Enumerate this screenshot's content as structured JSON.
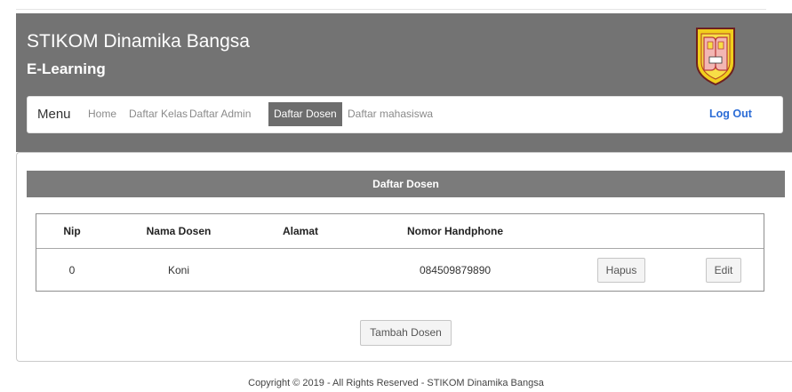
{
  "header": {
    "title": "STIKOM Dinamika Bangsa",
    "subtitle": "E-Learning",
    "logo_icon": "stikom-shield-logo"
  },
  "nav": {
    "menu_label": "Menu",
    "items": [
      {
        "label": "Home",
        "active": false
      },
      {
        "label": "Daftar Kelas",
        "active": false
      },
      {
        "label": "Daftar Admin",
        "active": false
      },
      {
        "label": "Daftar Dosen",
        "active": true
      },
      {
        "label": "Daftar mahasiswa",
        "active": false
      }
    ],
    "logout_label": "Log Out"
  },
  "panel": {
    "heading": "Daftar Dosen",
    "table": {
      "columns": [
        "Nip",
        "Nama Dosen",
        "Alamat",
        "Nomor Handphone"
      ],
      "rows": [
        {
          "nip": "0",
          "nama": "Koni",
          "alamat": "",
          "hp": "084509879890",
          "delete_label": "Hapus",
          "edit_label": "Edit"
        }
      ]
    },
    "add_button_label": "Tambah Dosen"
  },
  "footer": {
    "copyright": "Copyright © 2019 - All Rights Reserved - STIKOM Dinamika Bangsa"
  },
  "theme": {
    "header_bg": "#737373",
    "nav_active_bg": "#6d6d6d",
    "heading_bar_bg": "#7b7b7b",
    "logout_color": "#2b6cd6"
  }
}
